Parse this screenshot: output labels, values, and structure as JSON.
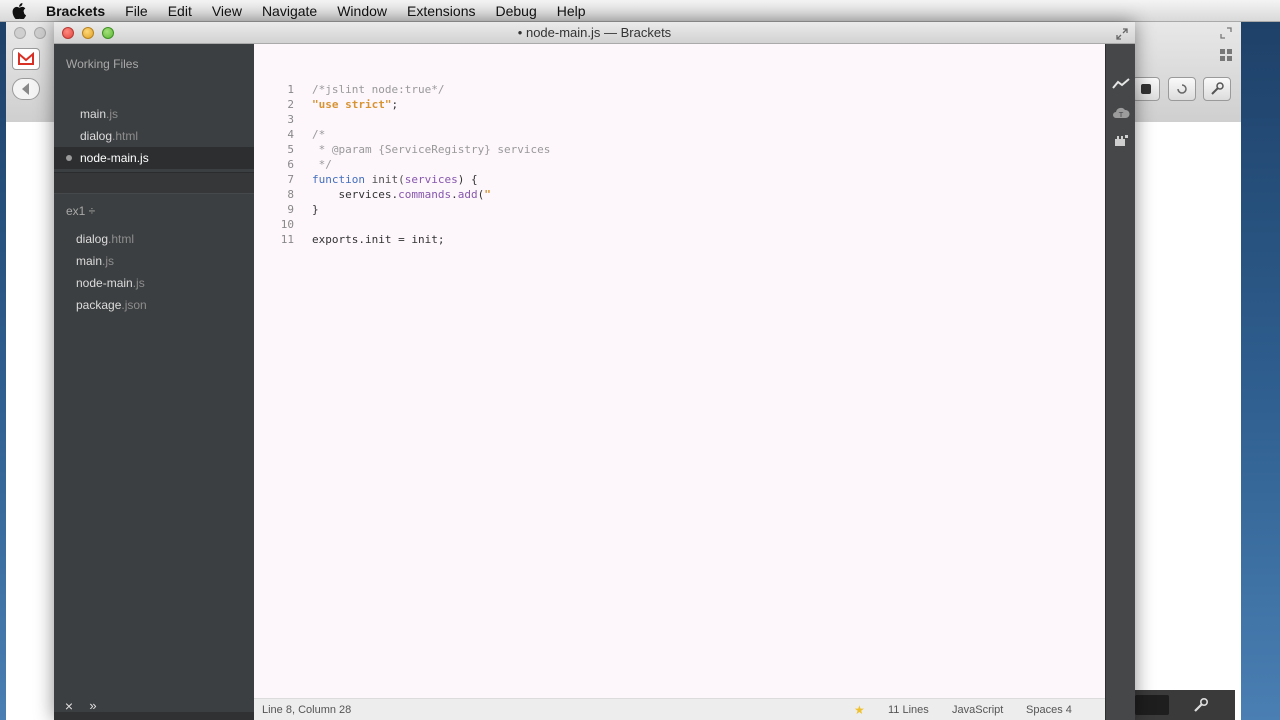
{
  "menubar": {
    "app_name": "Brackets",
    "items": [
      "File",
      "Edit",
      "View",
      "Navigate",
      "Window",
      "Extensions",
      "Debug",
      "Help"
    ]
  },
  "window": {
    "title": "• node-main.js — Brackets"
  },
  "sidebar": {
    "working_files_heading": "Working Files",
    "working_files": [
      {
        "name": "main",
        "ext": ".js"
      },
      {
        "name": "dialog",
        "ext": ".html"
      },
      {
        "name": "node-main.js",
        "ext": ""
      }
    ],
    "project_name": "ex1 ÷",
    "project_files": [
      {
        "name": "dialog",
        "ext": ".html"
      },
      {
        "name": "main",
        "ext": ".js"
      },
      {
        "name": "node-main",
        "ext": ".js"
      },
      {
        "name": "package",
        "ext": ".json"
      }
    ],
    "close_label": "×",
    "split_label": "»"
  },
  "editor": {
    "line_numbers": [
      "1",
      "2",
      "3",
      "4",
      "5",
      "6",
      "7",
      "8",
      "9",
      "10",
      "11"
    ],
    "lines": [
      {
        "tokens": [
          {
            "t": "/*jslint node:true*/",
            "c": "c-comment"
          }
        ]
      },
      {
        "tokens": [
          {
            "t": "\"use strict\"",
            "c": "c-string"
          },
          {
            "t": ";",
            "c": ""
          }
        ]
      },
      {
        "tokens": []
      },
      {
        "tokens": [
          {
            "t": "/*",
            "c": "c-comment"
          }
        ]
      },
      {
        "tokens": [
          {
            "t": " * @param {ServiceRegistry} services",
            "c": "c-comment"
          }
        ]
      },
      {
        "tokens": [
          {
            "t": " */",
            "c": "c-comment"
          }
        ]
      },
      {
        "tokens": [
          {
            "t": "function",
            "c": "c-keyword"
          },
          {
            "t": " init(",
            "c": "c-def"
          },
          {
            "t": "services",
            "c": "c-prop"
          },
          {
            "t": ") {",
            "c": ""
          }
        ]
      },
      {
        "tokens": [
          {
            "t": "    services.",
            "c": ""
          },
          {
            "t": "commands",
            "c": "c-prop"
          },
          {
            "t": ".",
            "c": ""
          },
          {
            "t": "add",
            "c": "c-prop"
          },
          {
            "t": "(",
            "c": ""
          },
          {
            "t": "\"",
            "c": "c-string"
          }
        ]
      },
      {
        "tokens": [
          {
            "t": "}",
            "c": ""
          }
        ]
      },
      {
        "tokens": []
      },
      {
        "tokens": [
          {
            "t": "exports.init = init;",
            "c": ""
          }
        ]
      }
    ]
  },
  "statusbar": {
    "cursor": "Line 8, Column 28",
    "lint_icon": "star-icon",
    "line_count": "11 Lines",
    "language": "JavaScript",
    "indent": "Spaces 4"
  },
  "toolbar": {
    "icons": [
      "live-preview-icon",
      "extension-manager-icon",
      "extension-plugin-icon"
    ]
  }
}
